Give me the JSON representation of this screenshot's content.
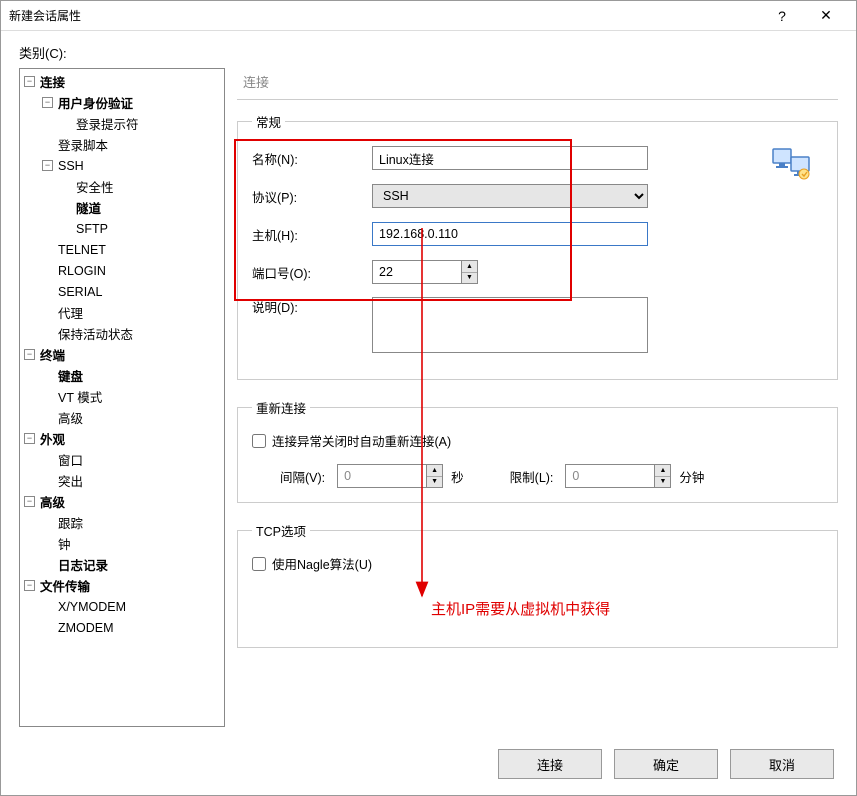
{
  "window": {
    "title": "新建会话属性",
    "help": "?",
    "close": "✕"
  },
  "category_label": "类别(C):",
  "tree": {
    "conn": "连接",
    "auth": "用户身份验证",
    "login_prompt": "登录提示符",
    "login_script": "登录脚本",
    "ssh": "SSH",
    "security": "安全性",
    "tunnel": "隧道",
    "sftp": "SFTP",
    "telnet": "TELNET",
    "rlogin": "RLOGIN",
    "serial": "SERIAL",
    "proxy": "代理",
    "keepalive": "保持活动状态",
    "terminal": "终端",
    "keyboard": "键盘",
    "vtmode": "VT 模式",
    "term_adv": "高级",
    "appearance": "外观",
    "window": "窗口",
    "highlight": "突出",
    "adv": "高级",
    "trace": "跟踪",
    "clock": "钟",
    "log": "日志记录",
    "file_transfer": "文件传输",
    "xymodem": "X/YMODEM",
    "zmodem": "ZMODEM"
  },
  "page_title": "连接",
  "general": {
    "legend": "常规",
    "name_label": "名称(N):",
    "name_value": "Linux连接",
    "protocol_label": "协议(P):",
    "protocol_value": "SSH",
    "host_label": "主机(H):",
    "host_value": "192.168.0.110",
    "port_label": "端口号(O):",
    "port_value": "22",
    "desc_label": "说明(D):",
    "desc_value": ""
  },
  "reconnect": {
    "legend": "重新连接",
    "check_label": "连接异常关闭时自动重新连接(A)",
    "interval_label": "间隔(V):",
    "interval_value": "0",
    "interval_unit": "秒",
    "limit_label": "限制(L):",
    "limit_value": "0",
    "limit_unit": "分钟"
  },
  "tcp": {
    "legend": "TCP选项",
    "nagle_label": "使用Nagle算法(U)"
  },
  "annot": {
    "text": "主机IP需要从虚拟机中获得"
  },
  "buttons": {
    "connect": "连接",
    "ok": "确定",
    "cancel": "取消"
  }
}
